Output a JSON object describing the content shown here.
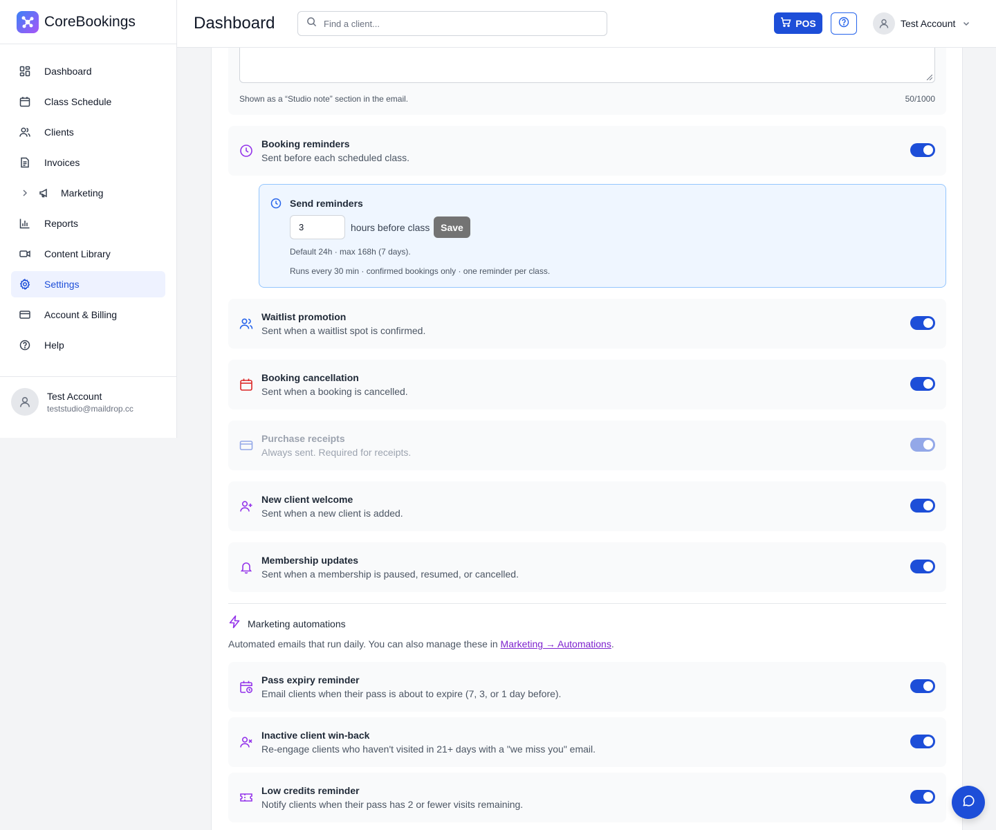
{
  "brand": {
    "name": "CoreBookings"
  },
  "sidebar": {
    "items": [
      {
        "label": "Dashboard",
        "icon": "dashboard-icon"
      },
      {
        "label": "Class Schedule",
        "icon": "calendar-icon"
      },
      {
        "label": "Clients",
        "icon": "users-icon"
      },
      {
        "label": "Invoices",
        "icon": "file-icon"
      },
      {
        "label": "Marketing",
        "icon": "megaphone-icon"
      },
      {
        "label": "Reports",
        "icon": "bar-chart-icon"
      },
      {
        "label": "Content Library",
        "icon": "video-icon"
      },
      {
        "label": "Settings",
        "icon": "gear-icon"
      },
      {
        "label": "Account & Billing",
        "icon": "credit-card-icon"
      },
      {
        "label": "Help",
        "icon": "help-icon"
      }
    ],
    "active": "Settings",
    "user": {
      "name": "Test Account",
      "email": "teststudio@maildrop.cc"
    }
  },
  "header": {
    "title": "Dashboard",
    "search_placeholder": "Find a client...",
    "pos_label": "POS",
    "account_name": "Test Account"
  },
  "studio_note": {
    "help": "Shown as a “Studio note” section in the email.",
    "count": "50/1000"
  },
  "booking_reminders": {
    "title": "Booking reminders",
    "desc": "Sent before each scheduled class.",
    "enabled": true
  },
  "send_reminders": {
    "title": "Send reminders",
    "value": "3",
    "unit": "hours before class",
    "save_label": "Save",
    "default_note": "Default 24h · max 168h (7 days).",
    "runs_note": "Runs every 30 min · confirmed bookings only · one reminder per class."
  },
  "notifications": [
    {
      "title": "Waitlist promotion",
      "desc": "Sent when a waitlist spot is confirmed.",
      "enabled": true
    },
    {
      "title": "Booking cancellation",
      "desc": "Sent when a booking is cancelled.",
      "enabled": true
    },
    {
      "title": "Purchase receipts",
      "desc": "Always sent. Required for receipts.",
      "enabled": true,
      "disabled": true
    },
    {
      "title": "New client welcome",
      "desc": "Sent when a new client is added.",
      "enabled": true
    },
    {
      "title": "Membership updates",
      "desc": "Sent when a membership is paused, resumed, or cancelled.",
      "enabled": true
    }
  ],
  "marketing": {
    "title": "Marketing automations",
    "desc_prefix": "Automated emails that run daily. You can also manage these in ",
    "link_label": "Marketing → Automations",
    "desc_suffix": ".",
    "items": [
      {
        "title": "Pass expiry reminder",
        "desc": "Email clients when their pass is about to expire (7, 3, or 1 day before).",
        "enabled": true
      },
      {
        "title": "Inactive client win-back",
        "desc": "Re-engage clients who haven't visited in 21+ days with a \"we miss you\" email.",
        "enabled": true
      },
      {
        "title": "Low credits reminder",
        "desc": "Notify clients when their pass has 2 or fewer visits remaining.",
        "enabled": true
      }
    ]
  },
  "colors": {
    "primary": "#1d4ed8",
    "accent_purple": "#7e22ce",
    "danger": "#dc2626",
    "active_bg": "#eef2ff"
  }
}
